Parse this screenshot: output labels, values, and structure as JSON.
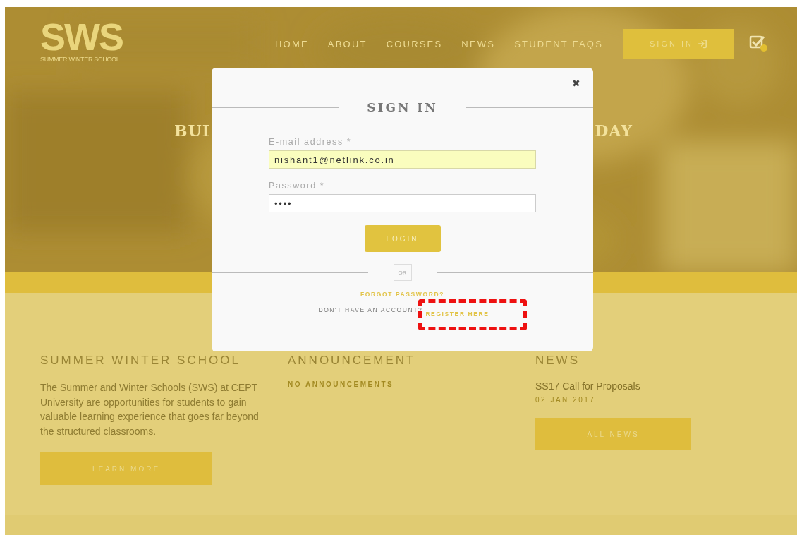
{
  "header": {
    "logo": "SWS",
    "tagline": "SUMMER WINTER SCHOOL",
    "nav": [
      {
        "label": "HOME"
      },
      {
        "label": "ABOUT"
      },
      {
        "label": "COURSES"
      },
      {
        "label": "NEWS"
      },
      {
        "label": "STUDENT FAQS"
      }
    ],
    "sign_in": "SIGN IN"
  },
  "hero": {
    "heading_left": "BUI",
    "heading_right": "DAY"
  },
  "modal": {
    "title": "SIGN IN",
    "close": "✖",
    "fields": [
      {
        "label": "E-mail address *",
        "value": "nishant1@netlink.co.in",
        "autofilled": true
      },
      {
        "label": "Password *",
        "value": "••••",
        "autofilled": false
      }
    ],
    "login": "LOGIN",
    "or": "OR",
    "forgot": "FORGOT PASSWORD?",
    "register_prompt": "DON'T HAVE AN ACCOUNT?",
    "register_link": "REGISTER HERE"
  },
  "sections": [
    {
      "title": "SUMMER WINTER SCHOOL",
      "text": "The Summer and Winter Schools (SWS) at CEPT University are opportunities for students to gain valuable learning experience that goes far beyond the structured classrooms.",
      "button": "LEARN MORE"
    },
    {
      "title": "ANNOUNCEMENT",
      "note": "NO ANNOUNCEMENTS"
    },
    {
      "title": "NEWS",
      "items": [
        {
          "title": "SS17 Call for Proposals",
          "date": "02 JAN 2017"
        }
      ],
      "button": "ALL NEWS"
    }
  ]
}
